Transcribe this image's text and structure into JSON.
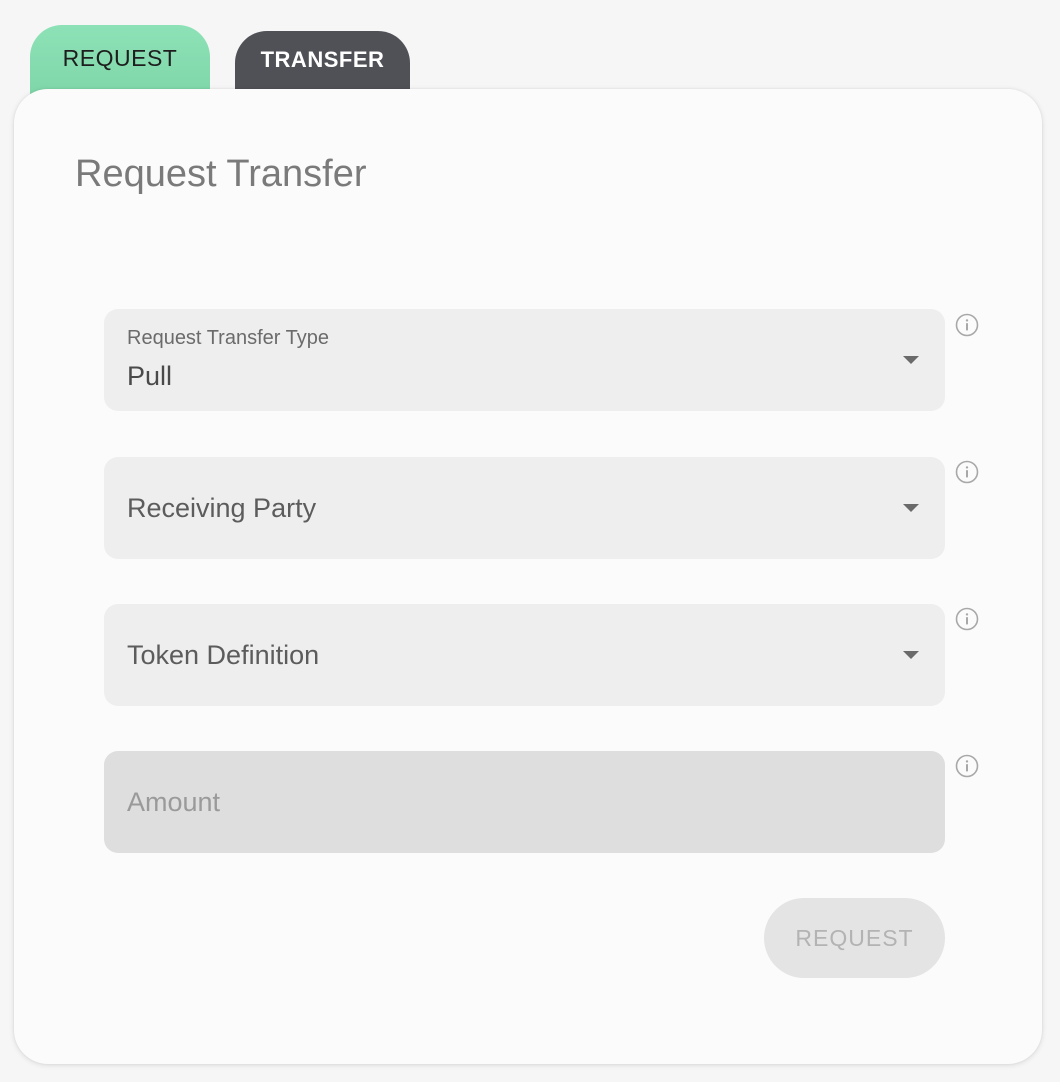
{
  "tabs": [
    {
      "label": "REQUEST",
      "active": true
    },
    {
      "label": "TRANSFER",
      "active": false
    }
  ],
  "card": {
    "title": "Request Transfer",
    "fields": [
      {
        "label": "Request Transfer Type",
        "value": "Pull",
        "type": "select",
        "icon": "info-icon"
      },
      {
        "placeholder": "Receiving Party",
        "type": "select",
        "icon": "info-icon"
      },
      {
        "placeholder": "Token Definition",
        "type": "select",
        "icon": "info-icon"
      },
      {
        "placeholder": "Amount",
        "type": "input",
        "disabled": true,
        "icon": "info-icon"
      }
    ],
    "submit_label": "REQUEST",
    "submit_disabled": true
  },
  "colors": {
    "active_tab": "#8de1b6",
    "inactive_tab": "#505157",
    "field_background": "#eeeeee",
    "disabled_field_background": "#dedede"
  }
}
